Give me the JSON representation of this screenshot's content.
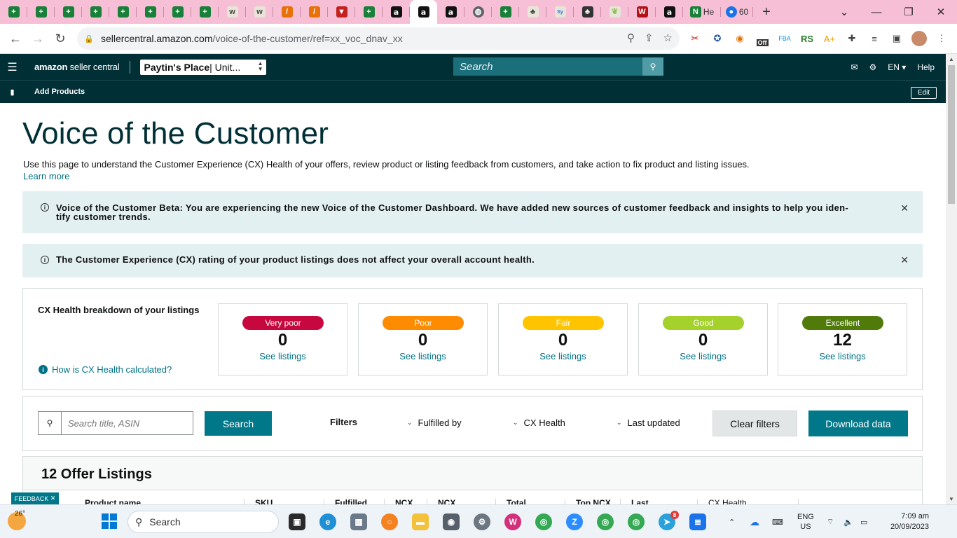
{
  "browser": {
    "tabs": [
      {
        "icon": "sheets-icon",
        "glyph": "+"
      },
      {
        "icon": "sheets-icon",
        "glyph": "+"
      },
      {
        "icon": "sheets-icon",
        "glyph": "+"
      },
      {
        "icon": "sheets-icon",
        "glyph": "+"
      },
      {
        "icon": "sheets-icon",
        "glyph": "+"
      },
      {
        "icon": "sheets-icon",
        "glyph": "+"
      },
      {
        "icon": "sheets-icon",
        "glyph": "+"
      },
      {
        "icon": "sheets-icon",
        "glyph": "+"
      }
    ],
    "tab_titles": {
      "partial_1": "He",
      "partial_2": "60"
    },
    "url_host": "sellercentral.amazon.com",
    "url_path": "/voice-of-the-customer/ref=xx_voc_dnav_xx",
    "ext_badge": "Off"
  },
  "header": {
    "brand_bold": "amazon",
    "brand_rest": " seller central",
    "store_name": "Paytin's Place",
    "store_region": " | Unit...",
    "search_placeholder": "Search",
    "lang": "EN",
    "help": "Help",
    "add_products": "Add Products",
    "edit": "Edit"
  },
  "page": {
    "title": "Voice of the Customer",
    "intro": "Use this page to understand the Customer Experience (CX) Health of your offers, review product or listing feedback from customers, and take action to fix product and listing issues.",
    "learn_more": "Learn more",
    "alert_beta_line1": "Voice of the Customer Beta: You are experiencing the new Voice of the Customer Dashboard. We have added new sources of customer feedback and insights to help you iden-",
    "alert_beta_line2": "tify customer trends.",
    "alert_cx": "The Customer Experience (CX) rating of your product listings does not affect your overall account health."
  },
  "cx_health": {
    "title": "CX Health breakdown of your listings",
    "help_link": "How is CX Health calculated?",
    "cards": [
      {
        "label": "Very poor",
        "count": "0",
        "link": "See listings",
        "color": "#c7083e"
      },
      {
        "label": "Poor",
        "count": "0",
        "link": "See listings",
        "color": "#ff8c00"
      },
      {
        "label": "Fair",
        "count": "0",
        "link": "See listings",
        "color": "#ffc400"
      },
      {
        "label": "Good",
        "count": "0",
        "link": "See listings",
        "color": "#a5d12d"
      },
      {
        "label": "Excellent",
        "count": "12",
        "link": "See listings",
        "color": "#507a0a"
      }
    ]
  },
  "filters": {
    "search_placeholder": "Search title, ASIN",
    "search_button": "Search",
    "label": "Filters",
    "fulfilled_by": "Fulfilled by",
    "cx_health": "CX Health",
    "last_updated": "Last updated",
    "clear": "Clear filters",
    "download": "Download data"
  },
  "listings": {
    "title": "12 Offer Listings",
    "columns": [
      "Product name",
      "SKU",
      "Fulfilled",
      "NCX",
      "NCX",
      "Total",
      "Top NCX",
      "Last",
      "CX Health"
    ]
  },
  "feedback_tab": "FEEDBACK",
  "taskbar": {
    "temperature": "26°",
    "search": "Search",
    "lang_top": "ENG",
    "lang_bottom": "US",
    "time": "7:09 am",
    "date": "20/09/2023",
    "telegram_badge": "8"
  }
}
